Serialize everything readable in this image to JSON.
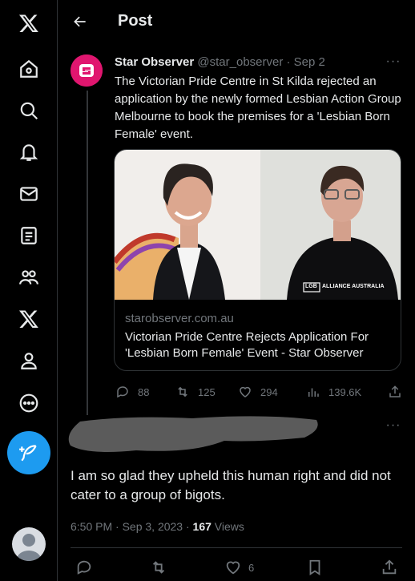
{
  "header": {
    "title": "Post"
  },
  "nav": {
    "items": [
      "x-logo-icon",
      "home-icon",
      "explore-icon",
      "notifications-icon",
      "messages-icon",
      "lists-icon",
      "communities-icon",
      "premium-x-icon",
      "profile-icon",
      "more-icon"
    ]
  },
  "source_post": {
    "name": "Star Observer",
    "handle_date": "@star_observer · Sep 2",
    "text": "The Victorian Pride Centre in St Kilda rejected an application by the newly formed Lesbian Action Group Melbourne to book the premises for a 'Lesbian Born Female' event.",
    "avatar_color": "#e0166f",
    "card": {
      "domain": "starobserver.com.au",
      "title": "Victorian Pride Centre Rejects Application For 'Lesbian Born Female' Event - Star Observer",
      "shirt_text": "ALLIANCE AUSTRALIA",
      "shirt_badge": "LGB"
    },
    "stats": {
      "replies": "88",
      "reposts": "125",
      "likes": "294",
      "views": "139.6K"
    }
  },
  "reply": {
    "text": "I am so glad they upheld this human right and did not cater to a group of bigots.",
    "time_date": "6:50 PM · Sep 3, 2023 · ",
    "views_count": "167",
    "views_label": " Views",
    "likes": "6"
  },
  "colors": {
    "accent": "#1d9bf0",
    "text": "#e7e9ea",
    "muted": "#71767b",
    "border": "#2f3336"
  }
}
